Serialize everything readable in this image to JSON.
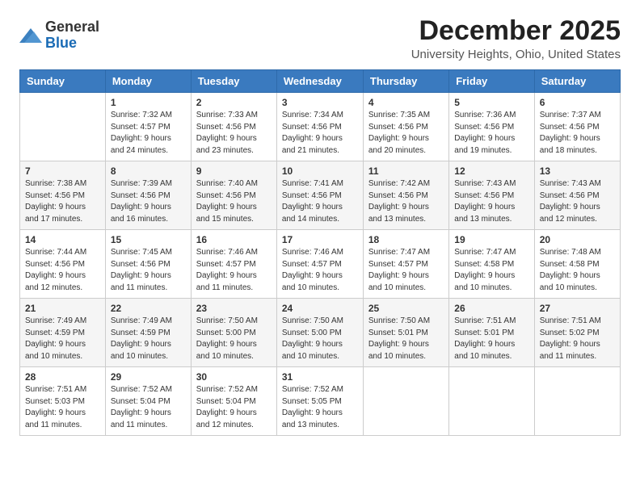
{
  "logo": {
    "general": "General",
    "blue": "Blue"
  },
  "header": {
    "month": "December 2025",
    "location": "University Heights, Ohio, United States"
  },
  "weekdays": [
    "Sunday",
    "Monday",
    "Tuesday",
    "Wednesday",
    "Thursday",
    "Friday",
    "Saturday"
  ],
  "weeks": [
    [
      {
        "day": "",
        "sunrise": "",
        "sunset": "",
        "daylight": ""
      },
      {
        "day": "1",
        "sunrise": "Sunrise: 7:32 AM",
        "sunset": "Sunset: 4:57 PM",
        "daylight": "Daylight: 9 hours and 24 minutes."
      },
      {
        "day": "2",
        "sunrise": "Sunrise: 7:33 AM",
        "sunset": "Sunset: 4:56 PM",
        "daylight": "Daylight: 9 hours and 23 minutes."
      },
      {
        "day": "3",
        "sunrise": "Sunrise: 7:34 AM",
        "sunset": "Sunset: 4:56 PM",
        "daylight": "Daylight: 9 hours and 21 minutes."
      },
      {
        "day": "4",
        "sunrise": "Sunrise: 7:35 AM",
        "sunset": "Sunset: 4:56 PM",
        "daylight": "Daylight: 9 hours and 20 minutes."
      },
      {
        "day": "5",
        "sunrise": "Sunrise: 7:36 AM",
        "sunset": "Sunset: 4:56 PM",
        "daylight": "Daylight: 9 hours and 19 minutes."
      },
      {
        "day": "6",
        "sunrise": "Sunrise: 7:37 AM",
        "sunset": "Sunset: 4:56 PM",
        "daylight": "Daylight: 9 hours and 18 minutes."
      }
    ],
    [
      {
        "day": "7",
        "sunrise": "Sunrise: 7:38 AM",
        "sunset": "Sunset: 4:56 PM",
        "daylight": "Daylight: 9 hours and 17 minutes."
      },
      {
        "day": "8",
        "sunrise": "Sunrise: 7:39 AM",
        "sunset": "Sunset: 4:56 PM",
        "daylight": "Daylight: 9 hours and 16 minutes."
      },
      {
        "day": "9",
        "sunrise": "Sunrise: 7:40 AM",
        "sunset": "Sunset: 4:56 PM",
        "daylight": "Daylight: 9 hours and 15 minutes."
      },
      {
        "day": "10",
        "sunrise": "Sunrise: 7:41 AM",
        "sunset": "Sunset: 4:56 PM",
        "daylight": "Daylight: 9 hours and 14 minutes."
      },
      {
        "day": "11",
        "sunrise": "Sunrise: 7:42 AM",
        "sunset": "Sunset: 4:56 PM",
        "daylight": "Daylight: 9 hours and 13 minutes."
      },
      {
        "day": "12",
        "sunrise": "Sunrise: 7:43 AM",
        "sunset": "Sunset: 4:56 PM",
        "daylight": "Daylight: 9 hours and 13 minutes."
      },
      {
        "day": "13",
        "sunrise": "Sunrise: 7:43 AM",
        "sunset": "Sunset: 4:56 PM",
        "daylight": "Daylight: 9 hours and 12 minutes."
      }
    ],
    [
      {
        "day": "14",
        "sunrise": "Sunrise: 7:44 AM",
        "sunset": "Sunset: 4:56 PM",
        "daylight": "Daylight: 9 hours and 12 minutes."
      },
      {
        "day": "15",
        "sunrise": "Sunrise: 7:45 AM",
        "sunset": "Sunset: 4:56 PM",
        "daylight": "Daylight: 9 hours and 11 minutes."
      },
      {
        "day": "16",
        "sunrise": "Sunrise: 7:46 AM",
        "sunset": "Sunset: 4:57 PM",
        "daylight": "Daylight: 9 hours and 11 minutes."
      },
      {
        "day": "17",
        "sunrise": "Sunrise: 7:46 AM",
        "sunset": "Sunset: 4:57 PM",
        "daylight": "Daylight: 9 hours and 10 minutes."
      },
      {
        "day": "18",
        "sunrise": "Sunrise: 7:47 AM",
        "sunset": "Sunset: 4:57 PM",
        "daylight": "Daylight: 9 hours and 10 minutes."
      },
      {
        "day": "19",
        "sunrise": "Sunrise: 7:47 AM",
        "sunset": "Sunset: 4:58 PM",
        "daylight": "Daylight: 9 hours and 10 minutes."
      },
      {
        "day": "20",
        "sunrise": "Sunrise: 7:48 AM",
        "sunset": "Sunset: 4:58 PM",
        "daylight": "Daylight: 9 hours and 10 minutes."
      }
    ],
    [
      {
        "day": "21",
        "sunrise": "Sunrise: 7:49 AM",
        "sunset": "Sunset: 4:59 PM",
        "daylight": "Daylight: 9 hours and 10 minutes."
      },
      {
        "day": "22",
        "sunrise": "Sunrise: 7:49 AM",
        "sunset": "Sunset: 4:59 PM",
        "daylight": "Daylight: 9 hours and 10 minutes."
      },
      {
        "day": "23",
        "sunrise": "Sunrise: 7:50 AM",
        "sunset": "Sunset: 5:00 PM",
        "daylight": "Daylight: 9 hours and 10 minutes."
      },
      {
        "day": "24",
        "sunrise": "Sunrise: 7:50 AM",
        "sunset": "Sunset: 5:00 PM",
        "daylight": "Daylight: 9 hours and 10 minutes."
      },
      {
        "day": "25",
        "sunrise": "Sunrise: 7:50 AM",
        "sunset": "Sunset: 5:01 PM",
        "daylight": "Daylight: 9 hours and 10 minutes."
      },
      {
        "day": "26",
        "sunrise": "Sunrise: 7:51 AM",
        "sunset": "Sunset: 5:01 PM",
        "daylight": "Daylight: 9 hours and 10 minutes."
      },
      {
        "day": "27",
        "sunrise": "Sunrise: 7:51 AM",
        "sunset": "Sunset: 5:02 PM",
        "daylight": "Daylight: 9 hours and 11 minutes."
      }
    ],
    [
      {
        "day": "28",
        "sunrise": "Sunrise: 7:51 AM",
        "sunset": "Sunset: 5:03 PM",
        "daylight": "Daylight: 9 hours and 11 minutes."
      },
      {
        "day": "29",
        "sunrise": "Sunrise: 7:52 AM",
        "sunset": "Sunset: 5:04 PM",
        "daylight": "Daylight: 9 hours and 11 minutes."
      },
      {
        "day": "30",
        "sunrise": "Sunrise: 7:52 AM",
        "sunset": "Sunset: 5:04 PM",
        "daylight": "Daylight: 9 hours and 12 minutes."
      },
      {
        "day": "31",
        "sunrise": "Sunrise: 7:52 AM",
        "sunset": "Sunset: 5:05 PM",
        "daylight": "Daylight: 9 hours and 13 minutes."
      },
      {
        "day": "",
        "sunrise": "",
        "sunset": "",
        "daylight": ""
      },
      {
        "day": "",
        "sunrise": "",
        "sunset": "",
        "daylight": ""
      },
      {
        "day": "",
        "sunrise": "",
        "sunset": "",
        "daylight": ""
      }
    ]
  ]
}
